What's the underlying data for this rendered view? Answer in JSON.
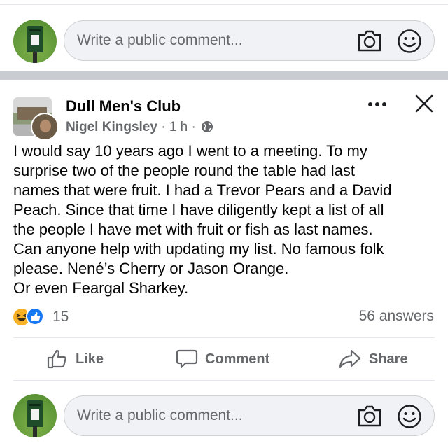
{
  "top_comment_box": {
    "placeholder": "Write a public comment..."
  },
  "post": {
    "group_name": "Dull Men's Club",
    "author": "Nigel Kingsley",
    "time": "1 h",
    "separator": "·",
    "privacy_icon": "globe-icon",
    "text_lines": [
      "I would say 10 years ago I went to a meeting. To my",
      "surprise two of the people round the table had last",
      "names that were fruit. I had a Trevor Pears and a David",
      "Peach. Since that time I have diligently kept a list of all",
      "the people I have met with fruit or fish as last names.",
      "Can anyone help with updating my list. No famous folk",
      "please. Nené’s Cherry or Jason Orange.",
      "Or even Feargal Sharkey."
    ],
    "reaction_count": "15",
    "answers": "56 answers"
  },
  "actions": {
    "like": "Like",
    "comment": "Comment",
    "share": "Share"
  },
  "bottom_comment_box": {
    "placeholder": "Write a public comment..."
  },
  "colors": {
    "text": "#050505",
    "secondary": "#65676b",
    "like_blue": "#1877f2",
    "haha_yellow": "#f7b125",
    "divider": "#c9ccd1"
  }
}
